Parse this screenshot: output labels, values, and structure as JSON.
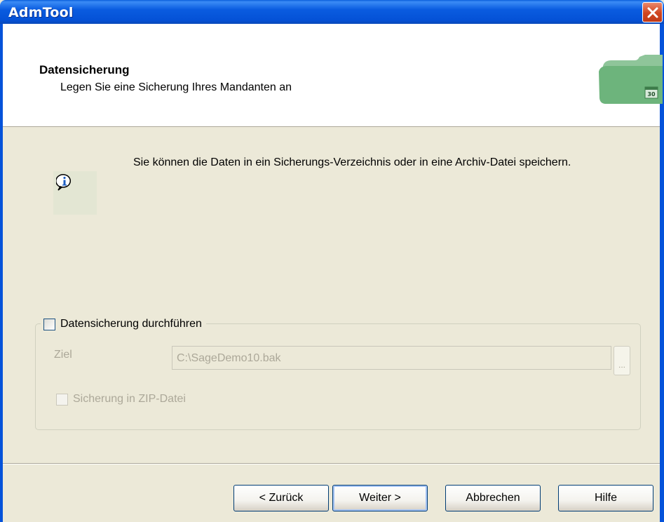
{
  "window": {
    "title": "AdmTool"
  },
  "header": {
    "title": "Datensicherung",
    "subtitle": "Legen Sie eine Sicherung Ihres Mandanten an",
    "graphic_badge": "30"
  },
  "info": {
    "icon": "info-icon",
    "text": "Sie können die Daten in ein Sicherungs-Verzeichnis oder in eine Archiv-Datei speichern."
  },
  "backup_group": {
    "checkbox_label": "Datensicherung durchführen",
    "checked": false,
    "target_label": "Ziel",
    "target_value": "C:\\SageDemo10.bak",
    "browse_label": "...",
    "zip_label": "Sicherung in ZIP-Datei",
    "zip_checked": false
  },
  "buttons": {
    "back": "< Zurück",
    "next": "Weiter >",
    "cancel": "Abbrechen",
    "help": "Hilfe"
  },
  "colors": {
    "titlebar": "#0553da",
    "dialog_background": "#ece9d8",
    "close_button": "#d0451f",
    "disabled_text": "#aca899"
  }
}
